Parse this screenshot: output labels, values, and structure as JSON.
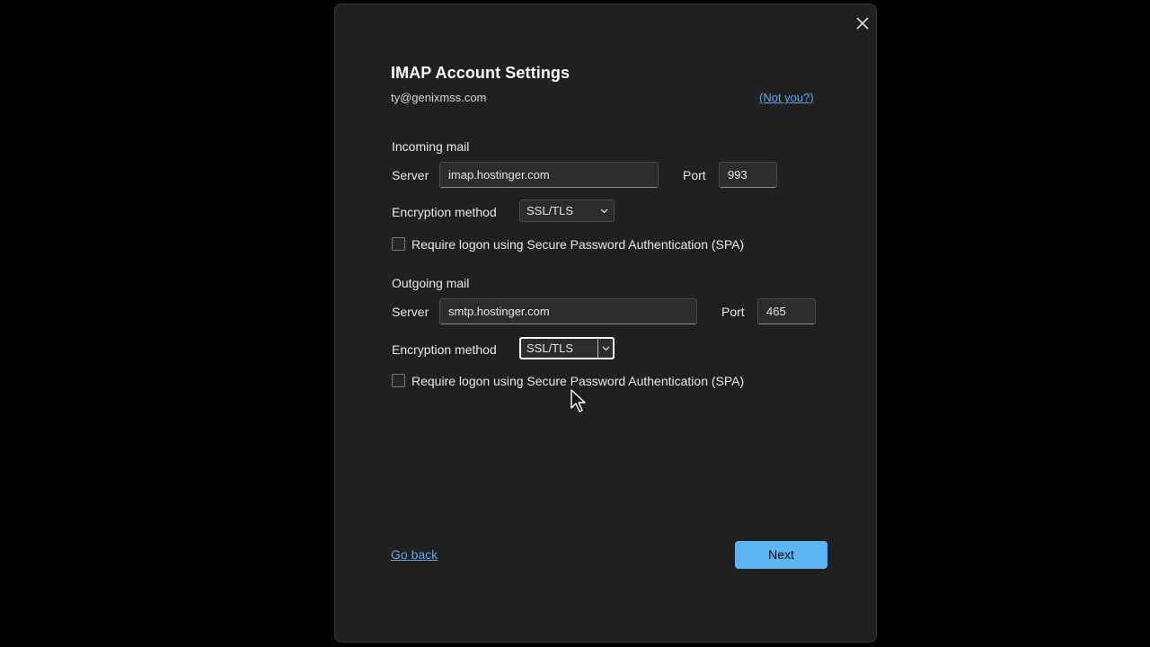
{
  "dialog": {
    "title": "IMAP Account Settings",
    "email": "ty@genixmss.com",
    "not_you_link": "(Not you?)",
    "close_icon": "close-icon"
  },
  "incoming": {
    "section_label": "Incoming mail",
    "server_label": "Server",
    "server_value": "imap.hostinger.com",
    "port_label": "Port",
    "port_value": "993",
    "encryption_label": "Encryption method",
    "encryption_value": "SSL/TLS",
    "spa_label": "Require logon using Secure Password Authentication (SPA)",
    "spa_checked": false
  },
  "outgoing": {
    "section_label": "Outgoing mail",
    "server_label": "Server",
    "server_value": "smtp.hostinger.com",
    "port_label": "Port",
    "port_value": "465",
    "encryption_label": "Encryption method",
    "encryption_value": "SSL/TLS",
    "spa_label": "Require logon using Secure Password Authentication (SPA)",
    "spa_checked": false
  },
  "footer": {
    "go_back_link": "Go back",
    "next_button": "Next"
  },
  "colors": {
    "background": "#000000",
    "dialog_background": "#202020",
    "link": "#5fa8e8",
    "primary_button": "#5cb4f2"
  }
}
